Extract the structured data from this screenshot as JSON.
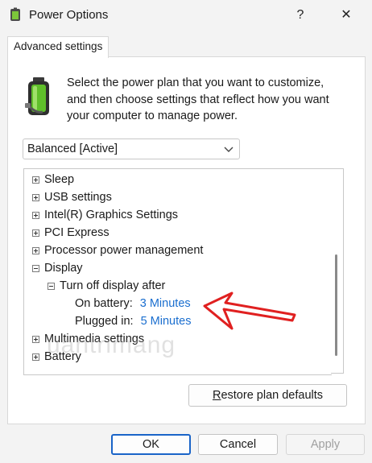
{
  "window": {
    "title": "Power Options",
    "help_glyph": "?",
    "close_glyph": "✕",
    "icon": "power-options-icon"
  },
  "tabs": [
    {
      "label": "Advanced settings",
      "active": true
    }
  ],
  "description": "Select the power plan that you want to customize, and then choose settings that reflect how you want your computer to manage power.",
  "plan_select": {
    "value": "Balanced [Active]",
    "icon": "chevron-down-icon"
  },
  "tree": {
    "items": [
      {
        "label": "Sleep",
        "expanded": false
      },
      {
        "label": "USB settings",
        "expanded": false
      },
      {
        "label": "Intel(R) Graphics Settings",
        "expanded": false
      },
      {
        "label": "PCI Express",
        "expanded": false
      },
      {
        "label": "Processor power management",
        "expanded": false
      },
      {
        "label": "Display",
        "expanded": true
      },
      {
        "label": "Turn off display after",
        "expanded": true
      },
      {
        "label": "On battery:",
        "value": "3 Minutes"
      },
      {
        "label": "Plugged in:",
        "value": "5 Minutes"
      },
      {
        "label": "Multimedia settings",
        "expanded": false
      },
      {
        "label": "Battery",
        "expanded": false
      }
    ]
  },
  "buttons": {
    "restore_first": "R",
    "restore_rest": "estore plan defaults",
    "ok": "OK",
    "cancel": "Cancel",
    "apply": "Apply"
  },
  "watermark": "uantrimang",
  "colors": {
    "accent": "#1a64c8",
    "link": "#1a6ecf",
    "arrow": "#e02020"
  }
}
